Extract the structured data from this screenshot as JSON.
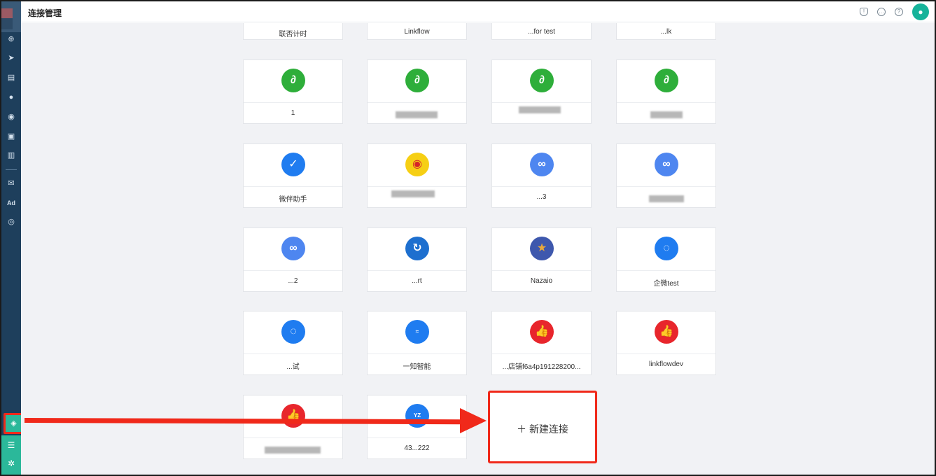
{
  "header": {
    "title": "连接管理",
    "icons": [
      "bell-icon",
      "message-icon",
      "help-icon",
      "user-avatar-icon"
    ]
  },
  "sidebar": {
    "icons": [
      "grid-icon",
      "send-icon",
      "layout-icon",
      "user-icon",
      "users-icon",
      "bookmark-icon",
      "bar-chart-icon",
      "wechat-icon",
      "ad-icon",
      "target-icon",
      "connection-icon",
      "database-icon",
      "settings-icon"
    ],
    "ad_label": "Ad"
  },
  "top_row": [
    "联否计时",
    "Linkflow",
    "...for test",
    "...lk"
  ],
  "cards": [
    {
      "label": "1",
      "icon": "mini-program-icon",
      "color": "#2eae3a"
    },
    {
      "label": "",
      "icon": "mini-program-icon",
      "color": "#2eae3a"
    },
    {
      "label": "",
      "icon": "mini-program-icon",
      "color": "#2eae3a"
    },
    {
      "label": "",
      "icon": "mini-program-icon",
      "color": "#2eae3a"
    },
    {
      "label": "微伴助手",
      "icon": "chat-check-icon",
      "color": "#1f7cf0"
    },
    {
      "label": "",
      "icon": "weibo-icon",
      "color": "#f6cf14"
    },
    {
      "label": "...3",
      "icon": "link-icon",
      "color": "#4e86f0"
    },
    {
      "label": "",
      "icon": "link-icon",
      "color": "#4e86f0"
    },
    {
      "label": "...2",
      "icon": "link-icon",
      "color": "#4e86f0"
    },
    {
      "label": "...rt",
      "icon": "refresh-chat-icon",
      "color": "#1d6fcf"
    },
    {
      "label": "Nazaio",
      "icon": "star-icon",
      "color": "#3e58ad"
    },
    {
      "label": "企微test",
      "icon": "chat-bubble-icon",
      "color": "#1f7cf0"
    },
    {
      "label": "...试",
      "icon": "chat-bubble-icon",
      "color": "#1f7cf0"
    },
    {
      "label": "一知智能",
      "icon": "yizhi-icon",
      "color": "#1f7cf0"
    },
    {
      "label": "...店铺f6a4p191228200...",
      "icon": "thumbs-up-icon",
      "color": "#e8262c"
    },
    {
      "label": "linkflowdev",
      "icon": "thumbs-up-icon",
      "color": "#e8262c"
    },
    {
      "label": "",
      "icon": "thumbs-up-icon",
      "color": "#e8262c"
    },
    {
      "label": "43...222",
      "icon": "youzan-icon",
      "color": "#1f7cf0"
    }
  ],
  "new_connection": {
    "plus": "＋",
    "label": "新建连接"
  }
}
